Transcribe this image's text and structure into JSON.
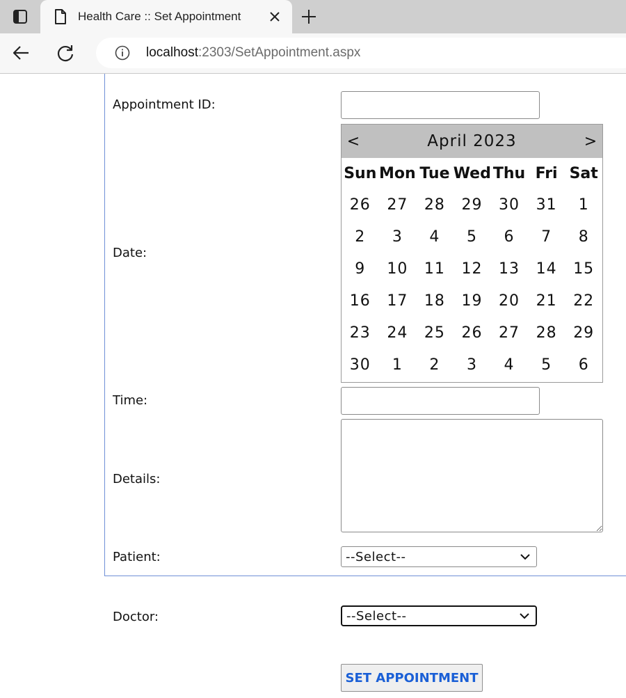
{
  "browser": {
    "tab_title": "Health Care :: Set Appointment",
    "url_host": "localhost",
    "url_rest": ":2303/SetAppointment.aspx"
  },
  "form": {
    "appointment_id_label": "Appointment ID:",
    "appointment_id_value": "",
    "date_label": "Date:",
    "time_label": "Time:",
    "time_value": "",
    "details_label": "Details:",
    "details_value": "",
    "patient_label": "Patient:",
    "patient_selected": "--Select--",
    "doctor_label": "Doctor:",
    "doctor_selected": "--Select--",
    "submit_label": "SET APPOINTMENT"
  },
  "calendar": {
    "title": "April 2023",
    "prev": "<",
    "next": ">",
    "weekdays": [
      "Sun",
      "Mon",
      "Tue",
      "Wed",
      "Thu",
      "Fri",
      "Sat"
    ],
    "weeks": [
      [
        "26",
        "27",
        "28",
        "29",
        "30",
        "31",
        "1"
      ],
      [
        "2",
        "3",
        "4",
        "5",
        "6",
        "7",
        "8"
      ],
      [
        "9",
        "10",
        "11",
        "12",
        "13",
        "14",
        "15"
      ],
      [
        "16",
        "17",
        "18",
        "19",
        "20",
        "21",
        "22"
      ],
      [
        "23",
        "24",
        "25",
        "26",
        "27",
        "28",
        "29"
      ],
      [
        "30",
        "1",
        "2",
        "3",
        "4",
        "5",
        "6"
      ]
    ]
  },
  "colors": {
    "panel_border": "#6f8fd6",
    "button_text": "#1a5fd6",
    "calendar_header": "#c0c0c0"
  }
}
